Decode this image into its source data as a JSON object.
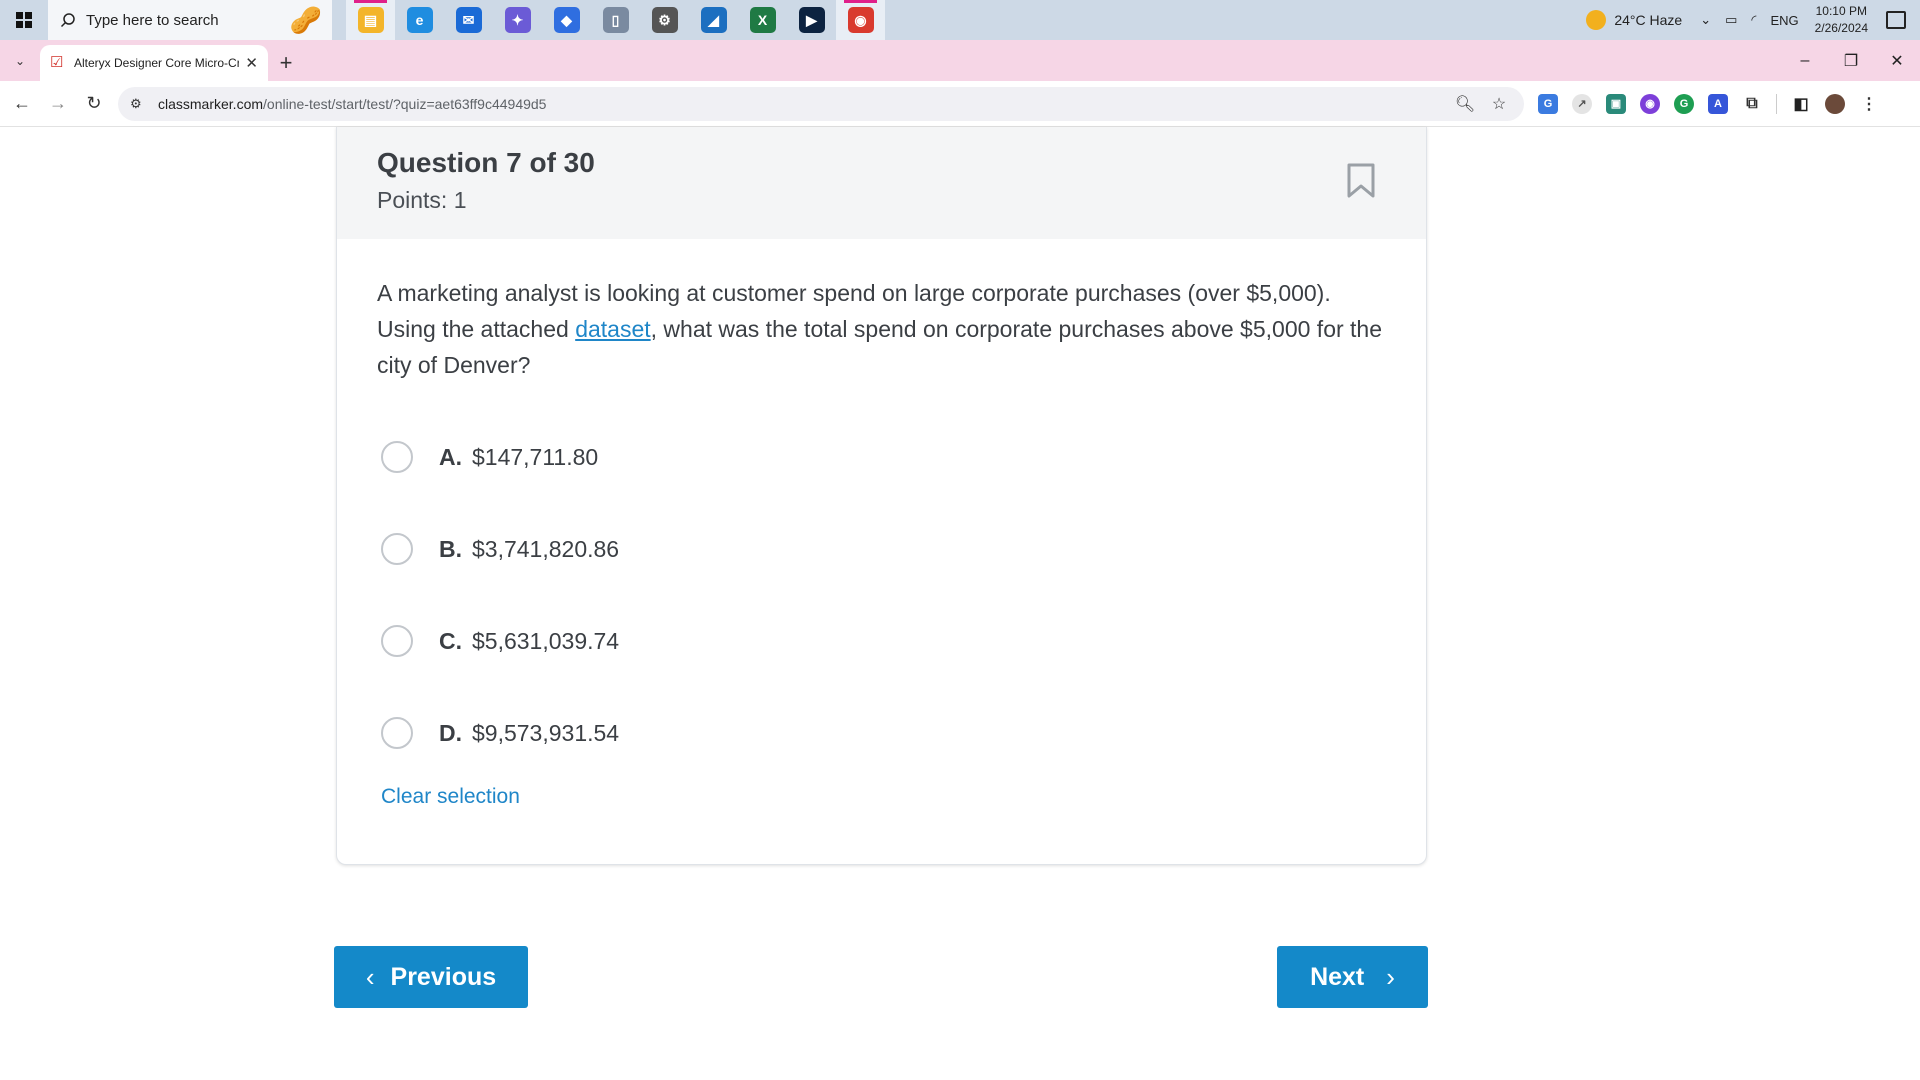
{
  "taskbar": {
    "search_placeholder": "Type here to search",
    "apps": [
      {
        "name": "file-explorer-icon",
        "color": "#f3b52a",
        "glyph": "▤",
        "active": true
      },
      {
        "name": "edge-icon",
        "color": "#1f8de0",
        "glyph": "e",
        "active": false
      },
      {
        "name": "mail-icon",
        "color": "#1a6ad6",
        "glyph": "✉",
        "active": false
      },
      {
        "name": "copilot-icon",
        "color": "#6b5bd6",
        "glyph": "✦",
        "active": false
      },
      {
        "name": "diamond-app-icon",
        "color": "#2f6ee0",
        "glyph": "◆",
        "active": false
      },
      {
        "name": "document-app-icon",
        "color": "#7a8aa0",
        "glyph": "▯",
        "active": false
      },
      {
        "name": "settings-icon",
        "color": "#555555",
        "glyph": "⚙",
        "active": false
      },
      {
        "name": "photos-app-icon",
        "color": "#1c6fc0",
        "glyph": "◢",
        "active": false
      },
      {
        "name": "excel-icon",
        "color": "#1f7a44",
        "glyph": "X",
        "active": false
      },
      {
        "name": "terminal-icon",
        "color": "#0d2340",
        "glyph": "▶",
        "active": false
      },
      {
        "name": "chrome-icon",
        "color": "#d93a2e",
        "glyph": "◉",
        "active": true
      }
    ],
    "weather": "24°C  Haze",
    "language": "ENG",
    "time": "10:10 PM",
    "date": "2/26/2024"
  },
  "browser": {
    "tab_title": "Alteryx Designer Core Micro-Cr",
    "url_host": "classmarker.com",
    "url_path": "/online-test/start/test/?quiz=aet63ff9c44949d5"
  },
  "question": {
    "title": "Question 7 of 30",
    "points": "Points: 1",
    "text_before": "A marketing analyst is looking at customer spend on large corporate purchases (over $5,000). Using the attached ",
    "link_text": "dataset",
    "text_after": ", what was the total spend on corporate purchases above $5,000 for the city of Denver?",
    "options": [
      {
        "letter": "A.",
        "value": "$147,711.80"
      },
      {
        "letter": "B.",
        "value": "$3,741,820.86"
      },
      {
        "letter": "C.",
        "value": "$5,631,039.74"
      },
      {
        "letter": "D.",
        "value": "$9,573,931.54"
      }
    ],
    "clear_label": "Clear selection"
  },
  "nav": {
    "previous_label": "Previous",
    "next_label": "Next"
  },
  "colors": {
    "accent": "#1489c9",
    "link": "#1f86c8",
    "tabstrip": "#f6d6e6"
  }
}
